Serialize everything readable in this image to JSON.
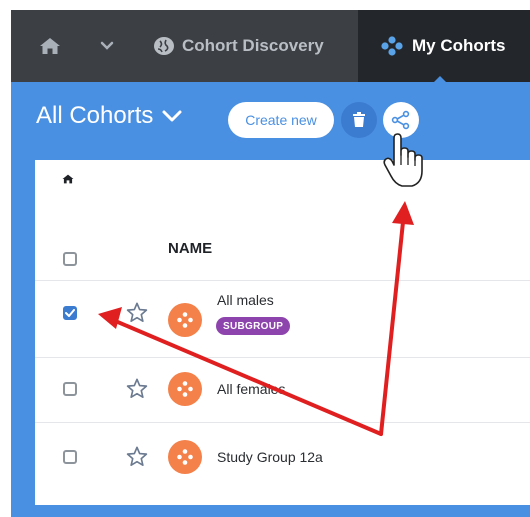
{
  "nav": {
    "cohort_discovery_label": "Cohort Discovery",
    "my_cohorts_label": "My Cohorts"
  },
  "toolbar": {
    "title": "All Cohorts",
    "create_new_label": "Create new"
  },
  "table": {
    "name_header": "NAME",
    "rows": [
      {
        "name": "All males",
        "badge": "SUBGROUP",
        "checked": true
      },
      {
        "name": "All females",
        "badge": "",
        "checked": false
      },
      {
        "name": "Study Group 12a",
        "badge": "",
        "checked": false
      }
    ]
  },
  "colors": {
    "nav_bg": "#3c3f44",
    "nav_active_bg": "#23262b",
    "accent_blue": "#4a90e2",
    "cohort_icon": "#f4814a",
    "badge_purple": "#8e44ad",
    "annotation_red": "#e02020"
  },
  "icons": [
    "home-icon",
    "chevron-down-icon",
    "brain-icon",
    "cohorts-icon",
    "trash-icon",
    "share-icon",
    "star-icon",
    "checkmark-icon",
    "hand-cursor-icon"
  ]
}
